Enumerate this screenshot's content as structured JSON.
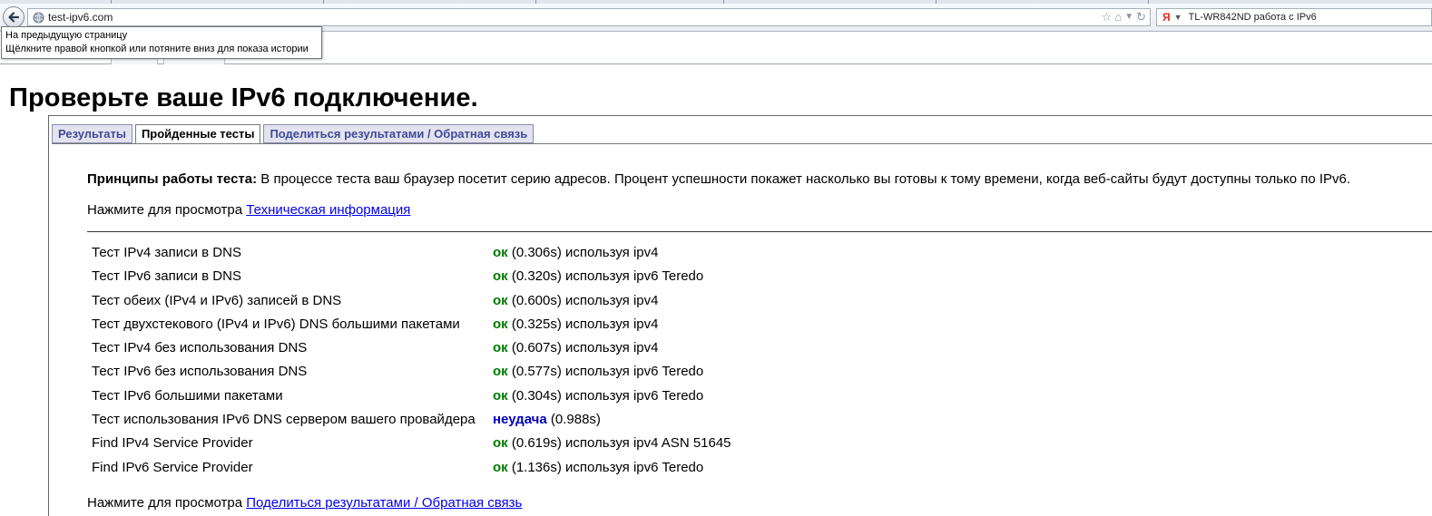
{
  "browser": {
    "url": "test-ipv6.com",
    "search_text": "TL-WR842ND работа с IPv6",
    "search_engine_letter": "Я",
    "tooltip": [
      "На предыдущую страницу",
      "Щёлкните правой кнопкой или потяните вниз для показа истории"
    ]
  },
  "page": {
    "title": "Проверьте ваше IPv6 подключение.",
    "tabs": [
      {
        "label": "Результаты",
        "active": false
      },
      {
        "label": "Пройденные тесты",
        "active": true
      },
      {
        "label": "Поделиться результатами / Обратная связь",
        "active": false
      }
    ],
    "principles_label": "Принципы работы теста:",
    "principles_text": " В процессе теста ваш браузер посетит серию адресов. Процент успешности покажет насколько вы готовы к тому времени, когда веб-сайты будут доступны только по IPv6.",
    "tech_prefix": "Нажмите для просмотра ",
    "tech_link": "Техническая информация",
    "share_prefix": "Нажмите для просмотра ",
    "share_link": "Поделиться результатами / Обратная связь"
  },
  "tests": [
    {
      "name": "Тест IPv4 записи в DNS",
      "status": "ок",
      "ok": true,
      "detail": " (0.306s) используя ipv4"
    },
    {
      "name": "Тест IPv6 записи в DNS",
      "status": "ок",
      "ok": true,
      "detail": " (0.320s) используя ipv6 Teredo"
    },
    {
      "name": "Тест обеих (IPv4 и IPv6) записей в DNS",
      "status": "ок",
      "ok": true,
      "detail": " (0.600s) используя ipv4"
    },
    {
      "name": "Тест двухстекового (IPv4 и IPv6) DNS большими пакетами",
      "status": "ок",
      "ok": true,
      "detail": " (0.325s) используя ipv4"
    },
    {
      "name": "Тест IPv4 без использования DNS",
      "status": "ок",
      "ok": true,
      "detail": " (0.607s) используя ipv4"
    },
    {
      "name": "Тест IPv6 без использования DNS",
      "status": "ок",
      "ok": true,
      "detail": " (0.577s) используя ipv6 Teredo"
    },
    {
      "name": "Тест IPv6 большими пакетами",
      "status": "ок",
      "ok": true,
      "detail": " (0.304s) используя ipv6 Teredo"
    },
    {
      "name": "Тест использования IPv6 DNS сервером вашего провайдера",
      "status": "неудача",
      "ok": false,
      "detail": " (0.988s)"
    },
    {
      "name": "Find IPv4 Service Provider",
      "status": "ок",
      "ok": true,
      "detail": " (0.619s) используя ipv4 ASN 51645"
    },
    {
      "name": "Find IPv6 Service Provider",
      "status": "ок",
      "ok": true,
      "detail": " (1.136s) используя ipv6 Teredo"
    }
  ],
  "colors": {
    "ok": "#007a00",
    "fail": "#0000bb",
    "link": "#0000ee",
    "tab_text": "#414a96"
  },
  "icons": [
    "back-arrow-icon",
    "globe-icon",
    "star-icon",
    "home-icon",
    "dropdown-icon",
    "refresh-icon"
  ]
}
